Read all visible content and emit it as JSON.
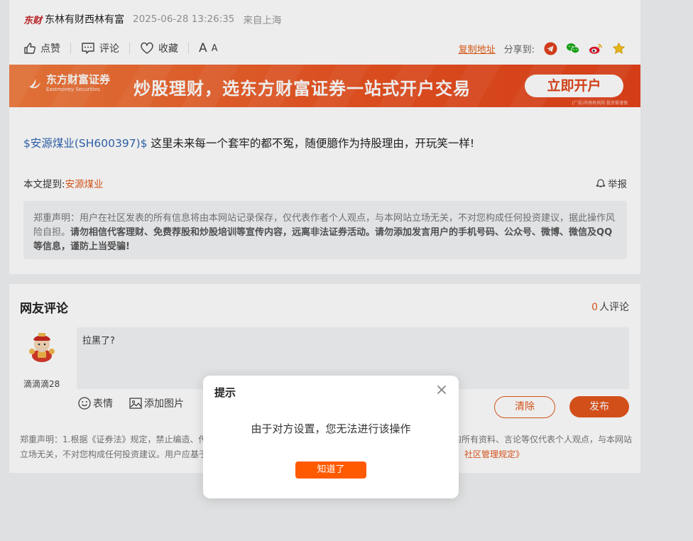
{
  "post": {
    "logo_text": "东财",
    "author": "东林有财西林有富",
    "timestamp": "2025-06-28 13:26:35",
    "location": "来自上海",
    "actions": {
      "like": "点赞",
      "comment": "评论",
      "favorite": "收藏",
      "font_size_big": "A",
      "font_size_small": "A"
    },
    "share": {
      "copy_link": "复制地址",
      "label": "分享到:"
    },
    "banner": {
      "brand_cn": "东方财富证券",
      "brand_en": "Eastmoney Securities",
      "slogan": "炒股理财，选东方财富证券一站式开户交易",
      "button": "立即开户",
      "note": "(广告)市场有风险 投资需谨慎"
    },
    "stock_tag": "$安源煤业(SH600397)$",
    "content": " 这里未来每一个套牢的都不冤，随便臆作为持股理由，开玩笑一样!",
    "mention_label": "本文提到:",
    "mention_stock": "安源煤业",
    "report": "举报",
    "disclaimer_plain": "郑重声明：用户在社区发表的所有信息将由本网站记录保存，仅代表作者个人观点，与本网站立场无关，不对您构成任何投资建议，据此操作风险自担。",
    "disclaimer_bold": "请勿相信代客理财、免费荐股和炒股培训等宣传内容，远离非法证券活动。请勿添加发言用户的手机号码、公众号、微博、微信及QQ等信息，谨防上当受骗!"
  },
  "comments": {
    "title": "网友评论",
    "count": "0",
    "count_suffix": "人评论",
    "username": "滴滴滴28",
    "input_value": "拉黑了?",
    "emoji": "表情",
    "add_image": "添加图片",
    "clear": "清除",
    "publish": "发布",
    "disclaimer_1": "郑重声明：1.根据《证券法》规定，禁止编造、传",
    "disclaimer_1_end": "的所有资料、言论等仅代表个人观点，与本网站",
    "disclaimer_2": "立场无关，不对您构成任何投资建议。用户应基于",
    "disclaimer_2_link": "社区管理规定》"
  },
  "modal": {
    "title": "提示",
    "message": "由于对方设置，您无法进行该操作",
    "confirm": "知道了"
  },
  "colors": {
    "accent": "#e35a1c",
    "banner_orange": "#ea5322",
    "link_blue": "#3267b2",
    "modal_button": "#ff5a00"
  }
}
